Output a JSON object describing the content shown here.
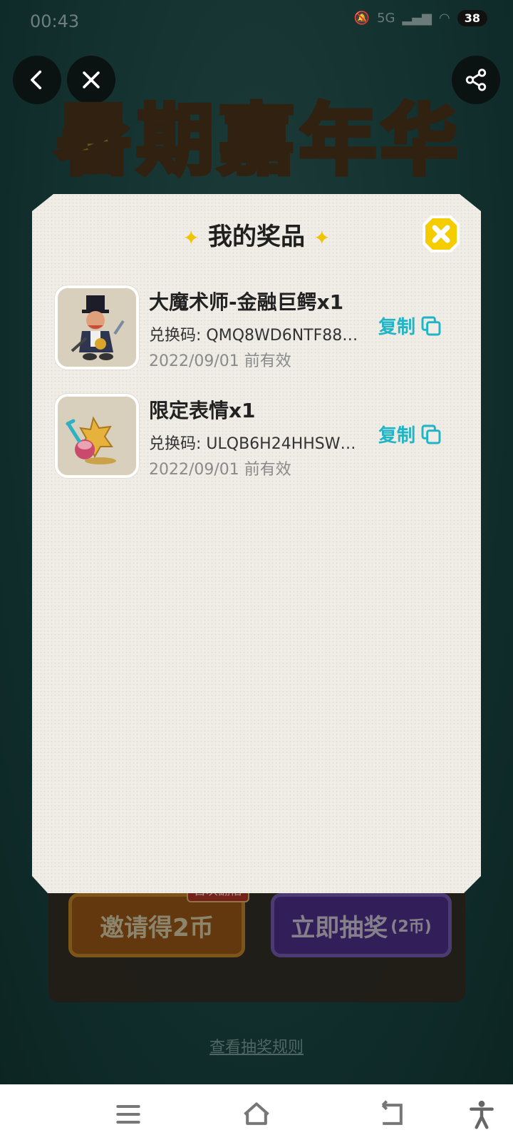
{
  "status_bar": {
    "time": "00:43",
    "network": "5G",
    "battery": "38"
  },
  "top_bar": {
    "back_icon": "chevron-left-icon",
    "close_icon": "close-icon",
    "share_icon": "share-icon"
  },
  "banner": {
    "title_chars": [
      "暑",
      "期",
      "嘉",
      "年",
      "华"
    ]
  },
  "modal": {
    "title": "我的奖品",
    "sparkle": "✦",
    "close_icon": "yellow-close-icon",
    "items": [
      {
        "name": "大魔术师-金融巨鳄x1",
        "code": "兑换码: QMQ8WD6NTF88…",
        "date": "2022/09/01 前有效",
        "copy_label": "复制"
      },
      {
        "name": "限定表情x1",
        "code": "兑换码: ULQB6H24HHSW…",
        "date": "2022/09/01 前有效",
        "copy_label": "复制"
      }
    ]
  },
  "background": {
    "invite_button": "邀请得2币",
    "badge": "首次翻倍",
    "draw_button": "立即抽奖",
    "draw_cost": "(2币)",
    "rules_link": "查看抽奖规则"
  },
  "nav": {
    "menu_icon": "menu-icon",
    "home_icon": "home-icon",
    "back_icon": "back-icon",
    "accessibility_icon": "accessibility-icon"
  },
  "colors": {
    "accent": "#1fb4c6",
    "close_yellow": "#f5cc00",
    "modal_bg": "#efede6"
  }
}
